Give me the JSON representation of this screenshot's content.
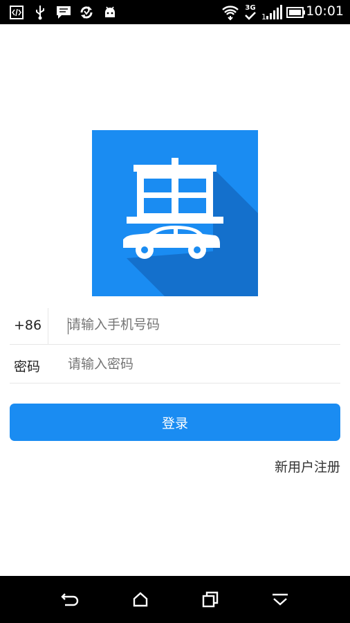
{
  "status_bar": {
    "time": "10:01",
    "network_type": "3G",
    "left_icons": [
      "code-icon",
      "usb-icon",
      "message-icon",
      "sync-icon",
      "android-icon"
    ],
    "right_icons": [
      "wifi-icon",
      "network-3g-icon",
      "signal-icon",
      "battery-icon"
    ]
  },
  "logo": {
    "character": "惠",
    "icon": "car-icon",
    "colors": {
      "background": "#1a8cf2",
      "shadow": "#1470cc",
      "foreground": "#ffffff"
    }
  },
  "form": {
    "phone": {
      "prefix": "+86",
      "placeholder": "请输入手机号码"
    },
    "password": {
      "label": "密码",
      "placeholder": "请输入密码"
    }
  },
  "login_button": {
    "label": "登录",
    "color": "#1a8cf2"
  },
  "register_link": {
    "label": "新用户注册"
  },
  "nav_bar": {
    "buttons": [
      "back-icon",
      "home-icon",
      "recents-icon",
      "hide-keyboard-icon"
    ]
  }
}
